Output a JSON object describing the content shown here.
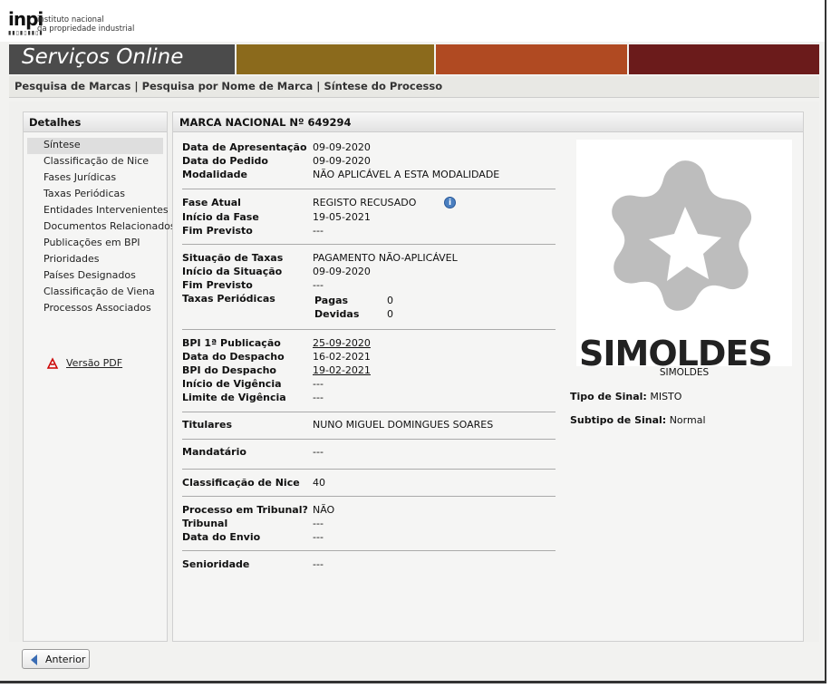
{
  "header": {
    "logo_mark": "inpi",
    "logo_line1": "instituto nacional",
    "logo_line2": "da propriedade industrial"
  },
  "banner": {
    "title": "Serviços Online",
    "colors": [
      "#4a4a4a",
      "#8a6a1a",
      "#b24a22",
      "#6a1c1c"
    ]
  },
  "breadcrumb": "Pesquisa de Marcas | Pesquisa por Nome de Marca | Síntese do Processo",
  "sidebar": {
    "title": "Detalhes",
    "items": [
      {
        "label": "Síntese"
      },
      {
        "label": "Classificação de Nice"
      },
      {
        "label": "Fases Jurídicas"
      },
      {
        "label": "Taxas Periódicas"
      },
      {
        "label": "Entidades Intervenientes"
      },
      {
        "label": "Documentos Relacionados"
      },
      {
        "label": "Publicações em BPI"
      },
      {
        "label": "Prioridades"
      },
      {
        "label": "Países Designados"
      },
      {
        "label": "Classificação de Viena"
      },
      {
        "label": "Processos Associados"
      }
    ],
    "pdf_label": "Versão PDF"
  },
  "main": {
    "title": "MARCA NACIONAL Nº 649294",
    "data_apresentacao": {
      "label": "Data de Apresentação",
      "value": "09-09-2020"
    },
    "data_pedido": {
      "label": "Data do Pedido",
      "value": "09-09-2020"
    },
    "modalidade": {
      "label": "Modalidade",
      "value": "NÃO APLICÁVEL A ESTA MODALIDADE"
    },
    "fase_atual": {
      "label": "Fase Atual",
      "value": "REGISTO RECUSADO"
    },
    "inicio_fase": {
      "label": "Início da Fase",
      "value": "19-05-2021"
    },
    "fim_previsto1": {
      "label": "Fim Previsto",
      "value": "---"
    },
    "situacao_taxas": {
      "label": "Situação de Taxas",
      "value": "PAGAMENTO NÃO-APLICÁVEL"
    },
    "inicio_situacao": {
      "label": "Início da Situação",
      "value": "09-09-2020"
    },
    "fim_previsto2": {
      "label": "Fim Previsto",
      "value": "---"
    },
    "taxas_periodicas": {
      "label": "Taxas Periódicas",
      "pagas_label": "Pagas",
      "pagas_value": "0",
      "devidas_label": "Devidas",
      "devidas_value": "0"
    },
    "bpi_publicacao": {
      "label": "BPI 1ª Publicação",
      "value": "25-09-2020"
    },
    "data_despacho": {
      "label": "Data do Despacho",
      "value": "16-02-2021"
    },
    "bpi_despacho": {
      "label": "BPI do Despacho",
      "value": "19-02-2021"
    },
    "inicio_vigencia": {
      "label": "Início de Vigência",
      "value": "---"
    },
    "limite_vigencia": {
      "label": "Limite de Vigência",
      "value": "---"
    },
    "titulares": {
      "label": "Titulares",
      "value": "NUNO MIGUEL DOMINGUES SOARES"
    },
    "mandatario": {
      "label": "Mandatário",
      "value": "---"
    },
    "classificacao_nice": {
      "label": "Classificação de Nice",
      "value": "40"
    },
    "processo_tribunal": {
      "label": "Processo em Tribunal?",
      "value": "NÃO"
    },
    "tribunal": {
      "label": "Tribunal",
      "value": "---"
    },
    "data_envio": {
      "label": "Data do Envio",
      "value": "---"
    },
    "senioridade": {
      "label": "Senioridade",
      "value": "---"
    }
  },
  "mark": {
    "image_word": "SIMOLDES",
    "caption": "SIMOLDES",
    "tipo_label": "Tipo de Sinal:",
    "tipo_value": "MISTO",
    "subtipo_label": "Subtipo de Sinal:",
    "subtipo_value": "Normal"
  },
  "footer": {
    "back_label": "Anterior"
  }
}
